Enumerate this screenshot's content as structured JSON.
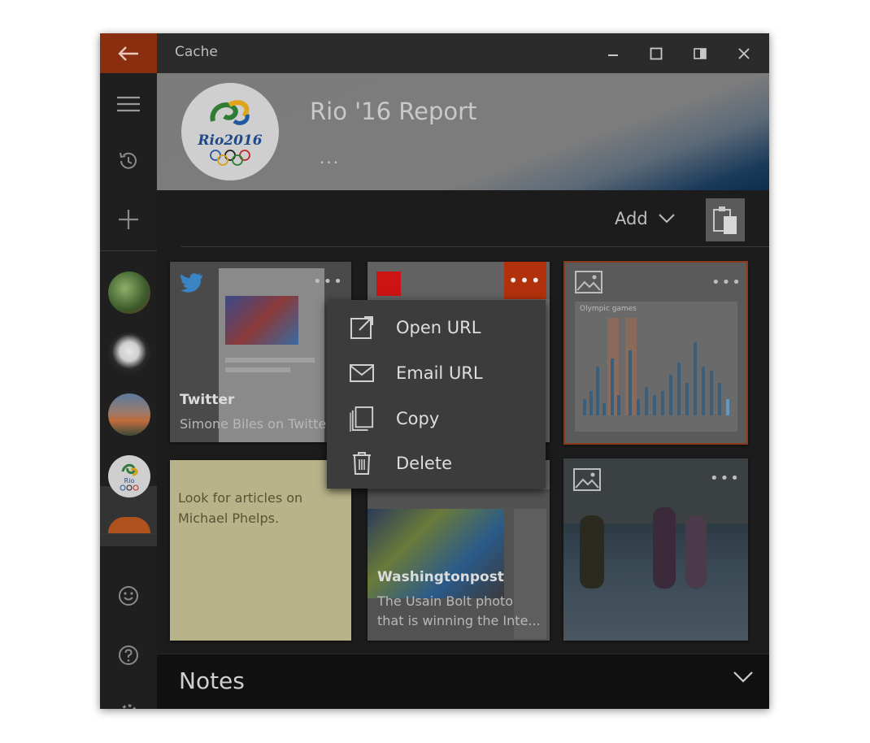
{
  "window": {
    "title": "Cache"
  },
  "header": {
    "title": "Rio '16 Report",
    "more": "...",
    "logo_text": "Rio2016"
  },
  "toolbar": {
    "add_label": "Add"
  },
  "cards": [
    {
      "title": "Twitter",
      "subtitle": "Simone Biles on Twitter",
      "more": "•••"
    },
    {
      "more": "•••"
    },
    {
      "more": "•••",
      "chart_label": "Olympic games"
    },
    {
      "note": "Look for articles on Michael Phelps."
    },
    {
      "title": "Washingtonpost",
      "subtitle_line1": "The Usain Bolt photo",
      "subtitle_line2": "that is winning the Inte..."
    },
    {
      "more": "•••"
    }
  ],
  "context_menu": {
    "items": [
      {
        "label": "Open URL",
        "icon": "open-external-icon"
      },
      {
        "label": "Email URL",
        "icon": "email-icon"
      },
      {
        "label": "Copy",
        "icon": "copy-icon"
      },
      {
        "label": "Delete",
        "icon": "trash-icon"
      }
    ]
  },
  "notes": {
    "title": "Notes"
  },
  "colors": {
    "accent": "#b0310b",
    "back": "#8a2e10",
    "note": "#b9b38a",
    "menu": "#3c3c3c"
  }
}
